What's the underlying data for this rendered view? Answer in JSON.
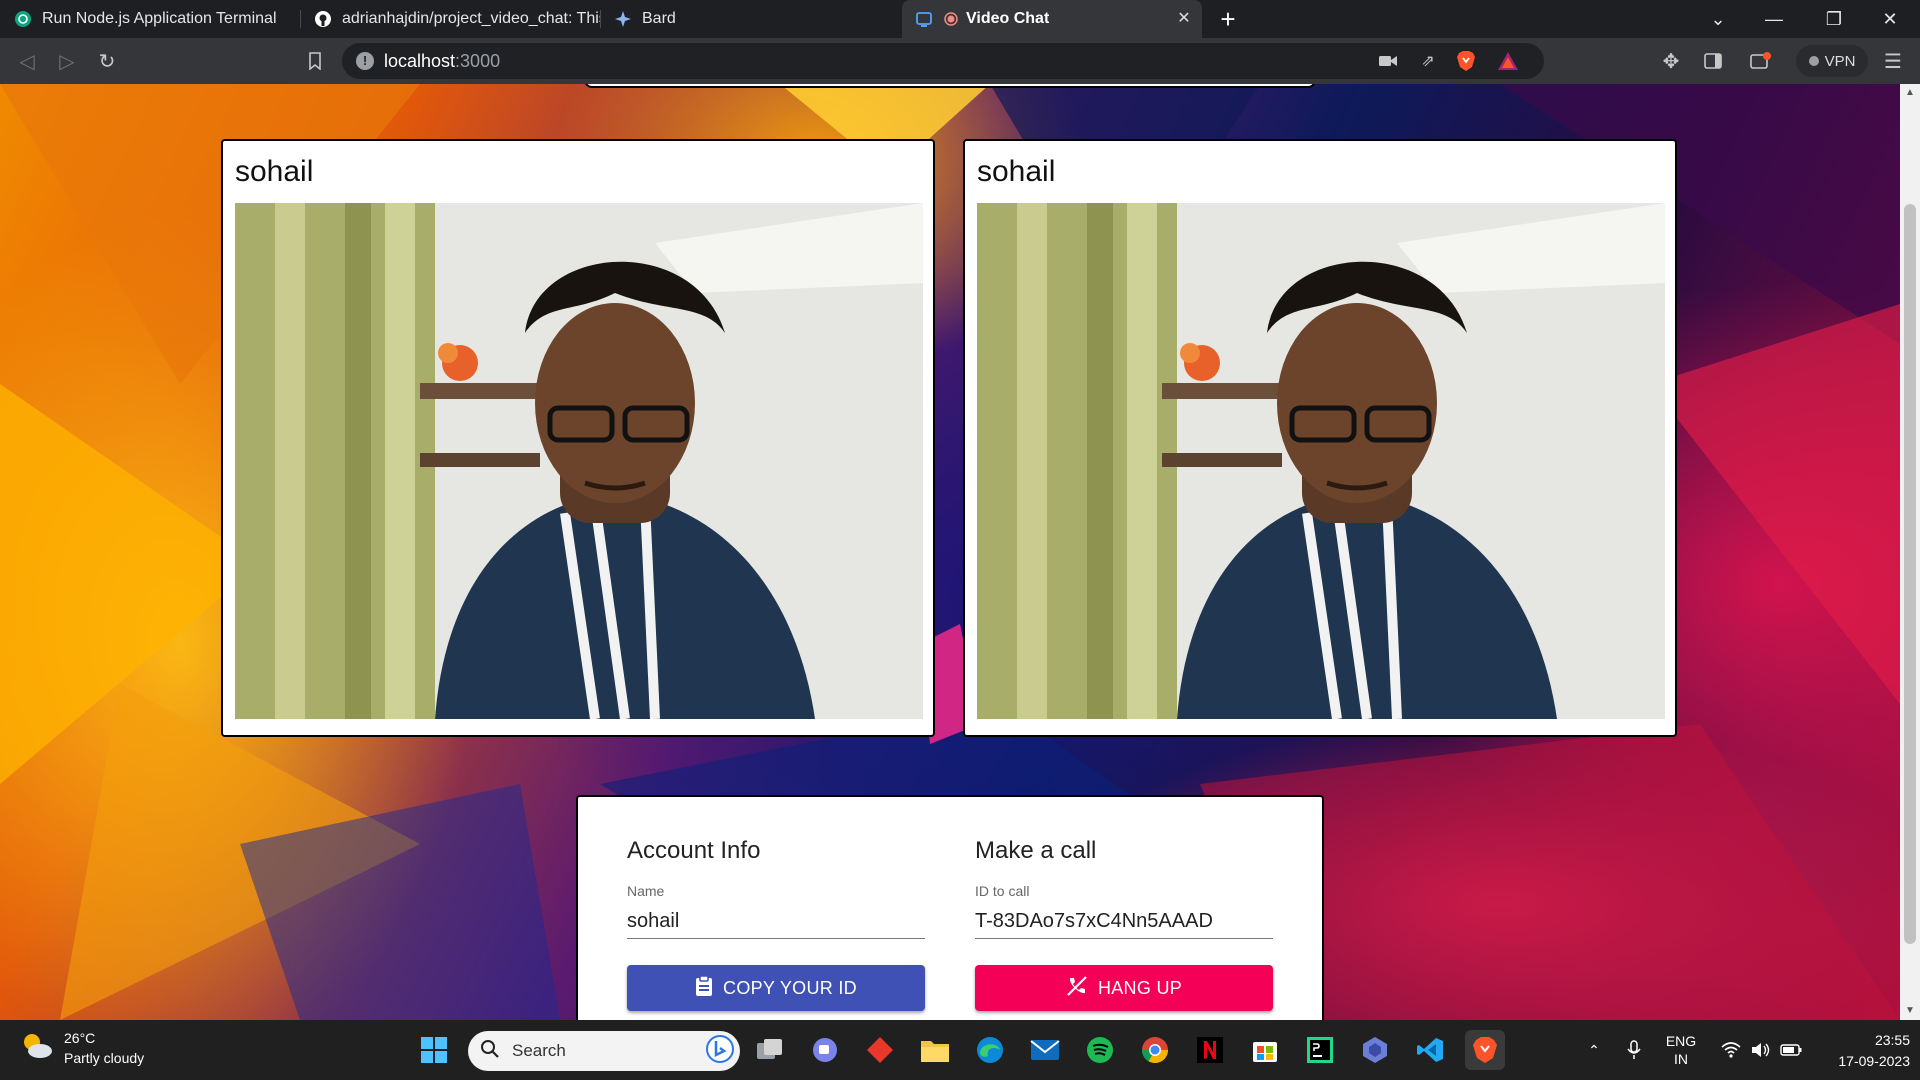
{
  "browser": {
    "tabs": [
      {
        "title": "Run Node.js Application Terminal",
        "favicon": "openai-icon"
      },
      {
        "title": "adrianhajdin/project_video_chat: This i",
        "favicon": "github-icon"
      },
      {
        "title": "Bard",
        "favicon": "bard-sparkle-icon"
      },
      {
        "title": "Video Chat",
        "favicon": "video-chat-icon",
        "active": true
      }
    ],
    "address": {
      "host": "localhost",
      "port": ":3000"
    },
    "vpn_label": "VPN"
  },
  "page": {
    "videos": [
      {
        "name": "sohail"
      },
      {
        "name": "sohail"
      }
    ],
    "account": {
      "heading": "Account Info",
      "name_label": "Name",
      "name_value": "sohail",
      "copy_button": "COPY YOUR ID"
    },
    "call": {
      "heading": "Make a call",
      "id_label": "ID to call",
      "id_value": "T-83DAo7s7xC4Nn5AAAD",
      "hangup_button": "HANG UP"
    }
  },
  "taskbar": {
    "weather": {
      "temp": "26°C",
      "condition": "Partly cloudy"
    },
    "search_placeholder": "Search",
    "language": {
      "line1": "ENG",
      "line2": "IN"
    },
    "clock": {
      "time": "23:55",
      "date": "17-09-2023"
    }
  },
  "colors": {
    "primary": "#3f51b5",
    "secondary": "#f50057"
  }
}
